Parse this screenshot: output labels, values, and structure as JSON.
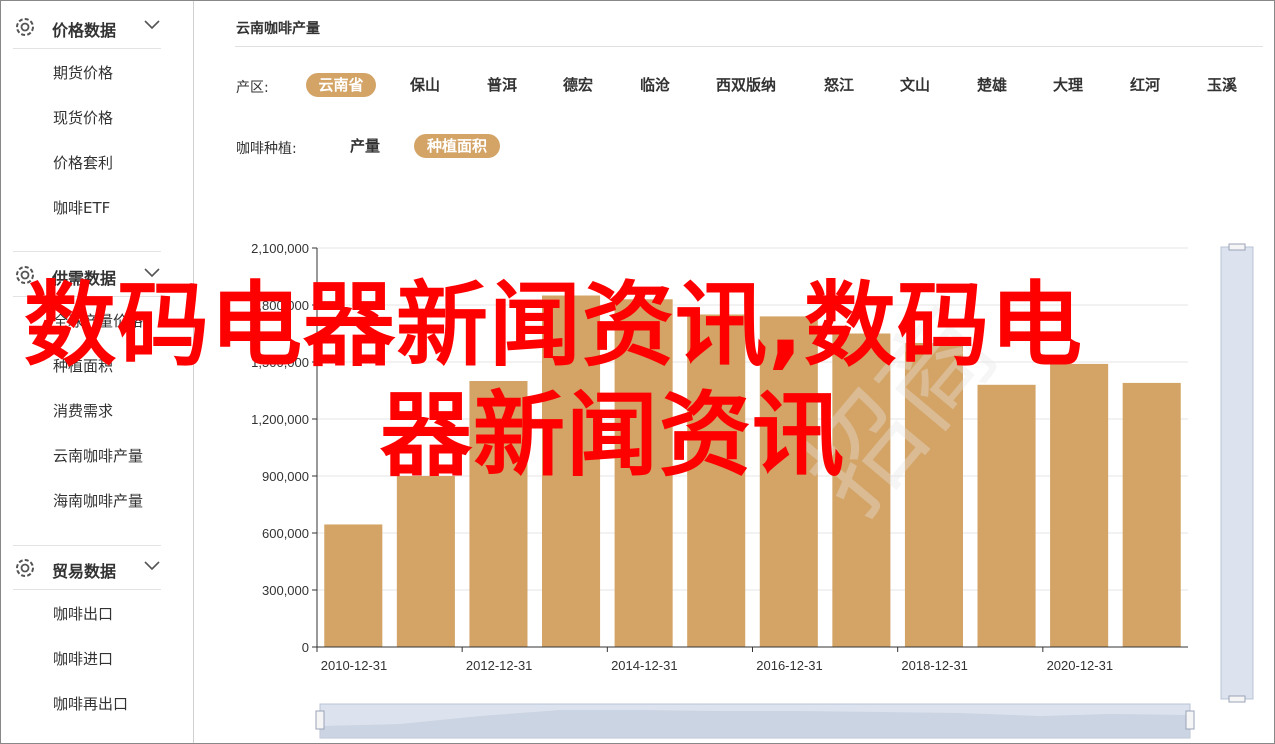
{
  "sidebar": {
    "groups": [
      {
        "title": "价格数据",
        "items": [
          "期货价格",
          "现货价格",
          "价格套利",
          "咖啡ETF"
        ]
      },
      {
        "title": "供需数据",
        "items": [
          "全球产量价格",
          "种植面积",
          "消费需求",
          "云南咖啡产量",
          "海南咖啡产量"
        ]
      },
      {
        "title": "贸易数据",
        "items": [
          "咖啡出口",
          "咖啡进口",
          "咖啡再出口"
        ]
      }
    ]
  },
  "main": {
    "title": "云南咖啡产量",
    "region_label": "产区:",
    "regions": [
      "云南省",
      "保山",
      "普洱",
      "德宏",
      "临沧",
      "西双版纳",
      "怒江",
      "文山",
      "楚雄",
      "大理",
      "红河",
      "玉溪"
    ],
    "region_selected": "云南省",
    "metric_label": "咖啡种植:",
    "metrics": [
      "产量",
      "种植面积"
    ],
    "metric_selected": "种植面积"
  },
  "overlay": {
    "line1": "数码电器新闻资讯,数码电",
    "line2": "器新闻资讯"
  },
  "chart_data": {
    "type": "bar",
    "categories": [
      "2010-12-31",
      "2011-12-31",
      "2012-12-31",
      "2013-12-31",
      "2014-12-31",
      "2015-12-31",
      "2016-12-31",
      "2017-12-31",
      "2018-12-31",
      "2019-12-31",
      "2020-12-31",
      "2021-12-31"
    ],
    "x_tick_labels": [
      "2010-12-31",
      "2012-12-31",
      "2014-12-31",
      "2016-12-31",
      "2018-12-31",
      "2020-12-31"
    ],
    "values": [
      645000,
      900000,
      1400000,
      1850000,
      1830000,
      1750000,
      1740000,
      1650000,
      1600000,
      1380000,
      1490000,
      1390000
    ],
    "ylim": [
      0,
      2100000
    ],
    "y_tick_labels": [
      "0",
      "300,000",
      "600,000",
      "900,000",
      "1,200,000",
      "1,500,000",
      "1,800,000",
      "2,100,000"
    ],
    "y_ticks": [
      0,
      300000,
      600000,
      900000,
      1200000,
      1500000,
      1800000,
      2100000
    ],
    "bar_color": "#d3a466",
    "grid": true
  }
}
